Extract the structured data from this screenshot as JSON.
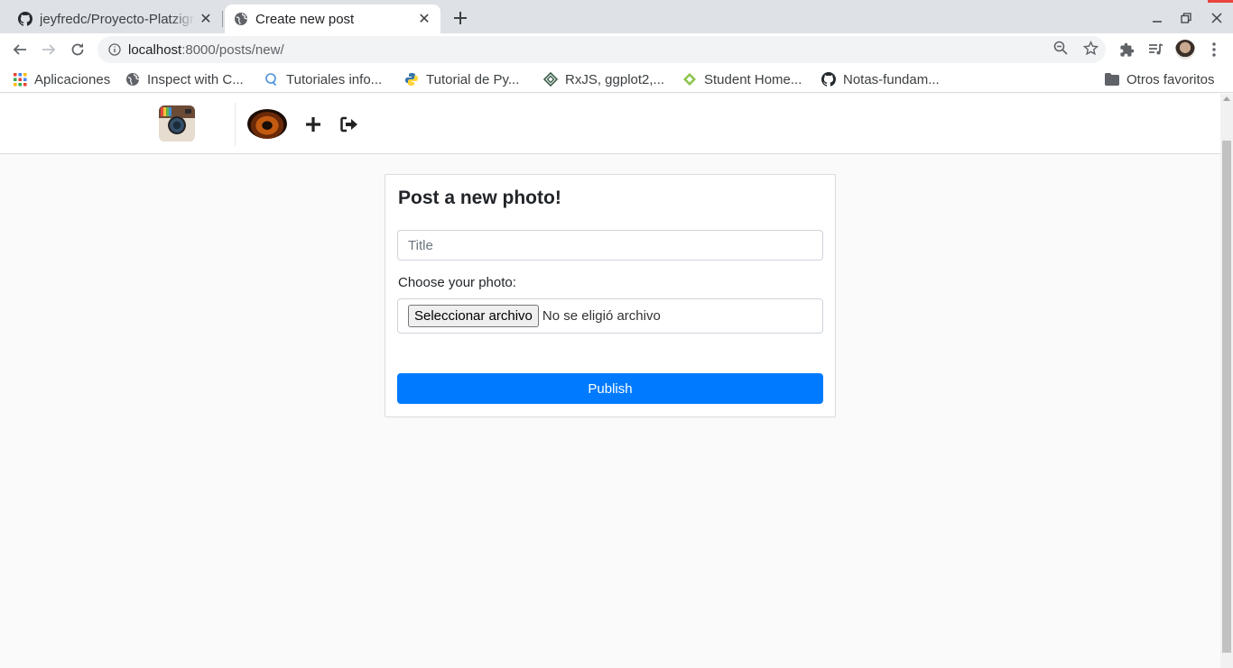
{
  "browser": {
    "tabs": [
      {
        "title": "jeyfredc/Proyecto-Platzigram",
        "icon": "github-icon",
        "active": false
      },
      {
        "title": "Create new post",
        "icon": "globe-icon",
        "active": true
      }
    ],
    "address": {
      "host": "localhost",
      "path": ":8000/posts/new/"
    },
    "bookmarks": [
      {
        "label": "Aplicaciones",
        "icon": "apps-grid-icon"
      },
      {
        "label": "Inspect with C...",
        "icon": "globe-icon"
      },
      {
        "label": "Tutoriales info...",
        "icon": "search-bubble-icon"
      },
      {
        "label": "Tutorial de Py...",
        "icon": "python-icon"
      },
      {
        "label": "RxJS, ggplot2,...",
        "icon": "devdocs-icon"
      },
      {
        "label": "Student Home...",
        "icon": "diamond-icon"
      },
      {
        "label": "Notas-fundam...",
        "icon": "github-icon"
      }
    ],
    "other_bookmarks": "Otros favoritos"
  },
  "page": {
    "form_title": "Post a new photo!",
    "title_placeholder": "Title",
    "choose_label": "Choose your photo:",
    "file_button": "Seleccionar archivo",
    "file_status": "No se eligió archivo",
    "publish_label": "Publish"
  },
  "colors": {
    "primary": "#007bff",
    "page_bg": "#fafafa",
    "tab_strip": "#dee1e6"
  }
}
